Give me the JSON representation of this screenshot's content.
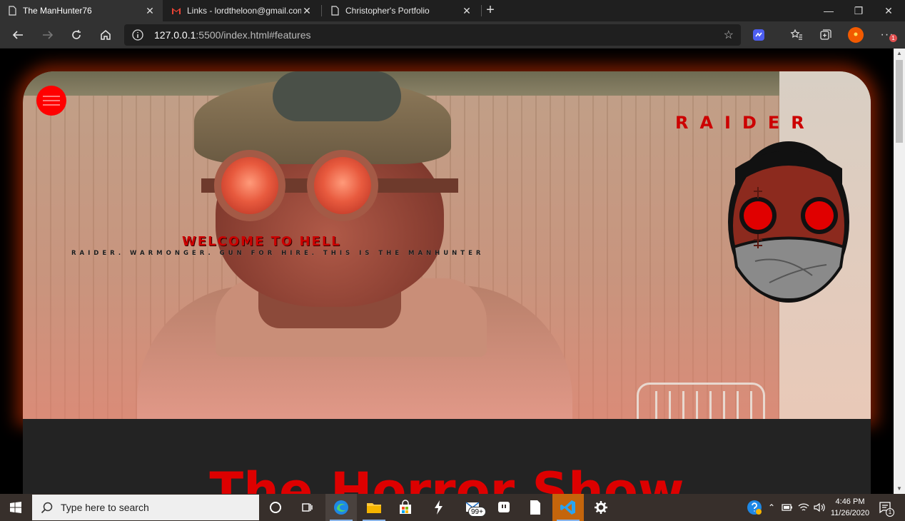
{
  "browser": {
    "tabs": [
      {
        "title": "The ManHunter76",
        "active": true
      },
      {
        "title": "Links - lordtheloon@gmail.com",
        "active": false
      },
      {
        "title": "Christopher's Portfolio",
        "active": false
      }
    ],
    "address": {
      "host": "127.0.0.1",
      "rest": ":5500/index.html#features"
    },
    "window_controls": {
      "minimize": "—",
      "restore": "❐",
      "close": "✕"
    },
    "new_tab": "+",
    "more_badge": "1"
  },
  "page": {
    "brand": "RAIDER",
    "welcome_title": "WELCOME TO HELL",
    "welcome_subtitle": "RAIDER. WARMONGER. GUN FOR HIRE. THIS IS THE MANHUNTER",
    "section_title": "The Horror Show",
    "accent_color": "#ff0000"
  },
  "taskbar": {
    "search_placeholder": "Type here to search",
    "mail_badge": "99+",
    "clock_time": "4:46 PM",
    "clock_date": "11/26/2020",
    "notification_count": "1"
  }
}
